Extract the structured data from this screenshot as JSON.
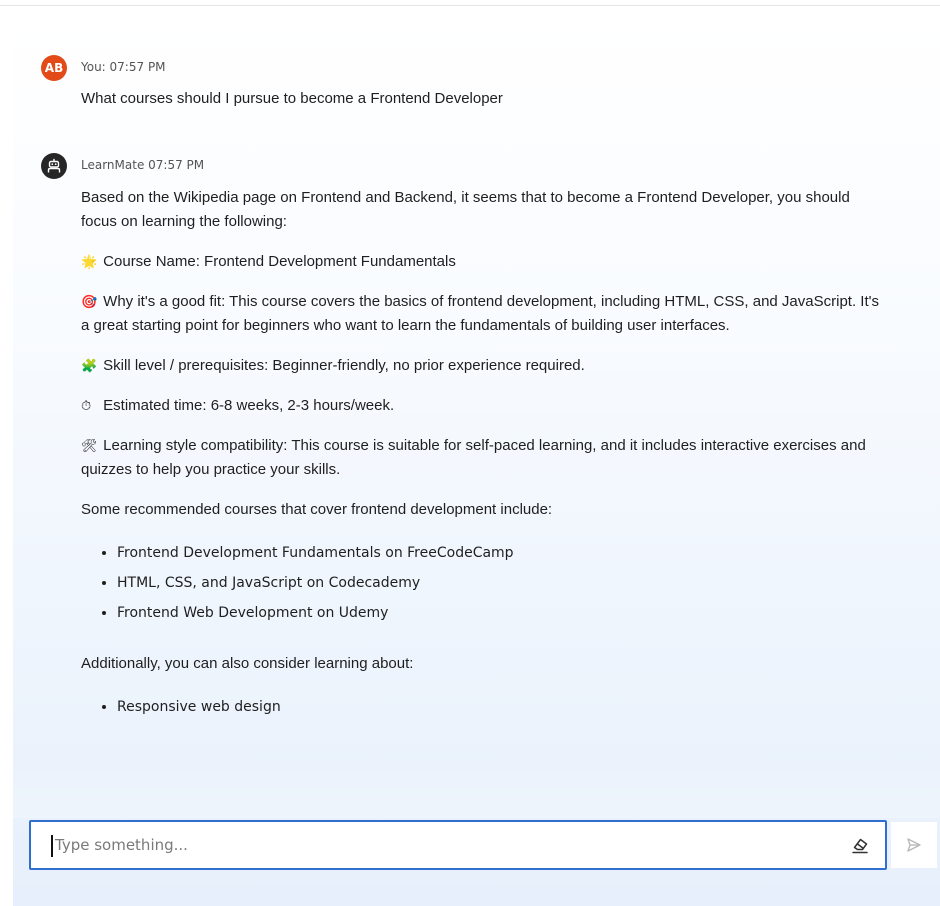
{
  "user_message": {
    "avatar_initials": "AB",
    "sender": "You: 07:57 PM",
    "text": "What courses should I pursue to become a Frontend Developer"
  },
  "bot_message": {
    "sender": "LearnMate 07:57 PM",
    "intro": "Based on the Wikipedia page on Frontend and Backend, it seems that to become a Frontend Developer, you should focus on learning the following:",
    "course_name": {
      "emoji": "🌟",
      "text": "Course Name: Frontend Development Fundamentals"
    },
    "why_fit": {
      "emoji": "🎯",
      "text": "Why it's a good fit: This course covers the basics of frontend development, including HTML, CSS, and JavaScript. It's a great starting point for beginners who want to learn the fundamentals of building user interfaces."
    },
    "skill_level": {
      "emoji": "🧩",
      "text": "Skill level / prerequisites: Beginner-friendly, no prior experience required."
    },
    "estimated_time": {
      "emoji": "⏱",
      "text": "Estimated time: 6-8 weeks, 2-3 hours/week."
    },
    "learning_style": {
      "emoji": "🛠",
      "text": "Learning style compatibility: This course is suitable for self-paced learning, and it includes interactive exercises and quizzes to help you practice your skills."
    },
    "recommended_intro": "Some recommended courses that cover frontend development include:",
    "recommended": [
      "Frontend Development Fundamentals on FreeCodeCamp",
      "HTML, CSS, and JavaScript on Codecademy",
      "Frontend Web Development on Udemy"
    ],
    "additional_intro": "Additionally, you can also consider learning about:",
    "additional": [
      "Responsive web design"
    ]
  },
  "input": {
    "placeholder": "Type something...",
    "value": ""
  },
  "icons": {
    "user_avatar": "avatar",
    "bot_avatar": "robot-icon",
    "clear": "eraser-icon",
    "send": "send-icon"
  },
  "colors": {
    "user_avatar": "#e24b18",
    "bot_avatar": "#262626",
    "input_border": "#2f6fd1"
  }
}
